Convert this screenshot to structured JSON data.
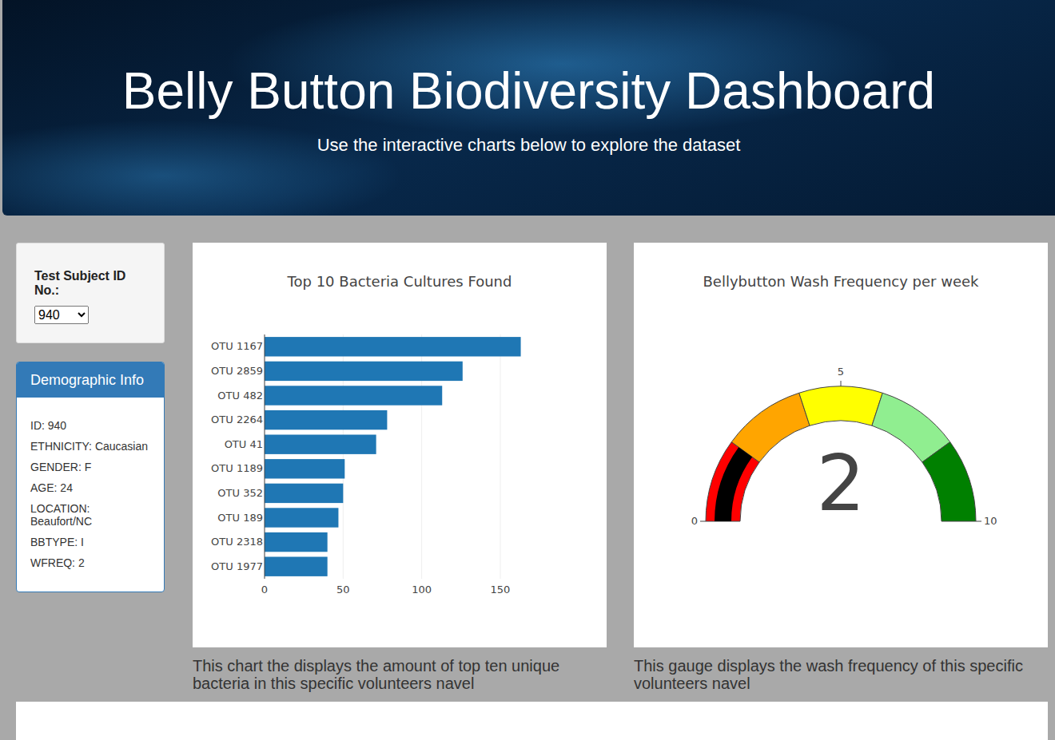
{
  "header": {
    "title": "Belly Button Biodiversity Dashboard",
    "subtitle": "Use the interactive charts below to explore the dataset"
  },
  "selector": {
    "label": "Test Subject ID No.:",
    "value": "940"
  },
  "demographics": {
    "title": "Demographic Info",
    "items": [
      "ID: 940",
      "ETHNICITY: Caucasian",
      "GENDER: F",
      "AGE: 24",
      "LOCATION: Beaufort/NC",
      "BBTYPE: I",
      "WFREQ: 2"
    ]
  },
  "bar_chart": {
    "title": "Top 10 Bacteria Cultures Found",
    "labels": [
      "OTU 1167",
      "OTU 2859",
      "OTU 482",
      "OTU 2264",
      "OTU 41",
      "OTU 1189",
      "OTU 352",
      "OTU 189",
      "OTU 2318",
      "OTU 1977"
    ],
    "values": [
      163,
      126,
      113,
      78,
      71,
      51,
      50,
      47,
      40,
      40
    ],
    "ticks": [
      "0",
      "50",
      "100",
      "150"
    ],
    "caption": "This chart the displays the amount of top ten unique bacteria in this specific volunteers navel"
  },
  "gauge": {
    "title": "Bellybutton Wash Frequency per week",
    "value": "2",
    "level": 0.2,
    "ticks": [
      "0",
      "5",
      "10"
    ],
    "segments": [
      {
        "color": "#ff0000"
      },
      {
        "color": "#ffa500"
      },
      {
        "color": "#ffff00"
      },
      {
        "color": "#90ee90"
      },
      {
        "color": "#008000"
      }
    ],
    "caption": "This gauge displays the wash frequency of this specific volunteers navel"
  }
}
